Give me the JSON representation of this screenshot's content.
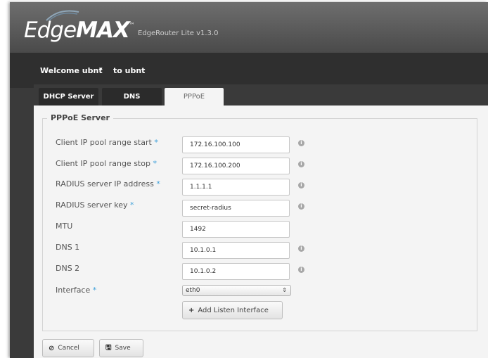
{
  "app": {
    "logo_light": "Edge",
    "logo_bold": "MAX",
    "logo_tm": "™",
    "version": "EdgeRouter Lite v1.3.0"
  },
  "userbar": {
    "welcome": "Welcome ubnt",
    "caret": "▾",
    "to_user": "to ubnt"
  },
  "tabs": [
    {
      "label": "DHCP Server",
      "active": false
    },
    {
      "label": "DNS",
      "active": false
    },
    {
      "label": "PPPoE",
      "active": true
    }
  ],
  "form": {
    "legend": "PPPoE Server",
    "required_marker": "*",
    "info_glyph": "i",
    "fields": [
      {
        "label": "Client IP pool range start",
        "required": true,
        "value": "172.16.100.100",
        "info": true
      },
      {
        "label": "Client IP pool range stop",
        "required": true,
        "value": "172.16.100.200",
        "info": true
      },
      {
        "label": "RADIUS server IP address",
        "required": true,
        "value": "1.1.1.1",
        "info": true
      },
      {
        "label": "RADIUS server key",
        "required": true,
        "value": "secret-radius",
        "info": true
      },
      {
        "label": "MTU",
        "required": false,
        "value": "1492",
        "info": false
      },
      {
        "label": "DNS 1",
        "required": false,
        "value": "10.1.0.1",
        "info": true
      },
      {
        "label": "DNS 2",
        "required": false,
        "value": "10.1.0.2",
        "info": true
      }
    ],
    "interface": {
      "label": "Interface",
      "required": true,
      "selected": "eth0",
      "arrow": "⇕"
    },
    "add_interface": {
      "icon": "+",
      "label": "Add Listen Interface"
    }
  },
  "actions": {
    "cancel": {
      "icon": "⊘",
      "label": "Cancel"
    },
    "save": {
      "icon": "🖫",
      "label": "Save"
    }
  },
  "colors": {
    "accent_required": "#3ea0da",
    "header_bg": "#5a5a5a",
    "userbar_bg": "#2f2f2f",
    "panel_bg": "#f4f4f4"
  }
}
